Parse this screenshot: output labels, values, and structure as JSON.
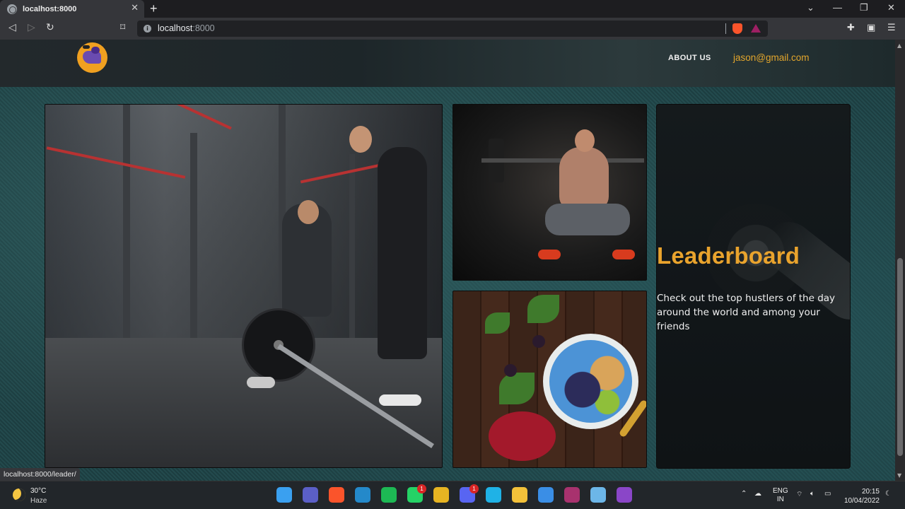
{
  "browser": {
    "tab_title": "localhost:8000",
    "tab_close": "✕",
    "new_tab": "+",
    "url_host": "localhost",
    "url_port": ":8000",
    "window_controls": [
      "⌄",
      "—",
      "❐",
      "✕"
    ],
    "icons": [
      "back-icon",
      "forward-icon",
      "reload-icon",
      "bookmark-icon",
      "site-info-icon",
      "brave-shields-icon",
      "brave-rewards-icon",
      "extensions-icon",
      "wallet-icon",
      "menu-icon"
    ]
  },
  "site": {
    "nav": {
      "about": "ABOUT US",
      "email": "jason@gmail.com"
    },
    "leaderboard": {
      "title": "Leaderboard",
      "description": "Check out the top hustlers of the day around the world and among your friends"
    },
    "colors": {
      "accent": "#e9a32d",
      "card_bg": "#12171a"
    },
    "images": [
      "gym-deadlift-photo",
      "barbell-squat-photo",
      "smoothie-bowl-photo",
      "dumbbell-photo"
    ]
  },
  "status_bar": {
    "link": "localhost:8000/leader/"
  },
  "taskbar": {
    "weather_temp": "30°C",
    "weather_condition": "Haze",
    "apps": [
      {
        "name": "start",
        "color": "#3aa0f0",
        "badge": ""
      },
      {
        "name": "teams",
        "color": "#5b5fc7",
        "badge": ""
      },
      {
        "name": "brave",
        "color": "#fb542b",
        "badge": ""
      },
      {
        "name": "vscode",
        "color": "#2489ca",
        "badge": ""
      },
      {
        "name": "spotify",
        "color": "#1db954",
        "badge": ""
      },
      {
        "name": "whatsapp",
        "color": "#25d366",
        "badge": "1"
      },
      {
        "name": "chrome",
        "color": "#e6b422",
        "badge": ""
      },
      {
        "name": "discord",
        "color": "#5865f2",
        "badge": "1"
      },
      {
        "name": "cortana",
        "color": "#1fb2e6",
        "badge": ""
      },
      {
        "name": "file-explorer",
        "color": "#f3c13a",
        "badge": ""
      },
      {
        "name": "photos",
        "color": "#3a8ee6",
        "badge": ""
      },
      {
        "name": "winrar",
        "color": "#a8326e",
        "badge": ""
      },
      {
        "name": "notepad",
        "color": "#6cb6e8",
        "badge": ""
      },
      {
        "name": "github-desktop",
        "color": "#8a46c8",
        "badge": ""
      }
    ],
    "language_top": "ENG",
    "language_bottom": "IN",
    "time": "20:15",
    "date": "10/04/2022"
  }
}
